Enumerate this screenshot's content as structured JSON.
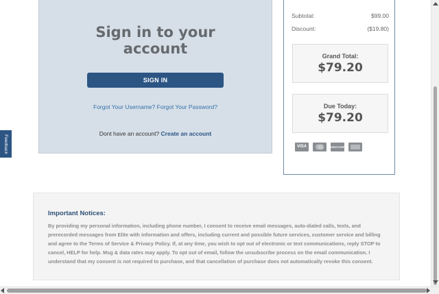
{
  "signin": {
    "title_line1": "Sign in to your",
    "title_line2": "account",
    "button_label": "SIGN IN",
    "forgot_username": "Forgot Your Username?",
    "forgot_password": "Forgot Your Password?",
    "no_account_text": "Dont have an account?",
    "create_account": "Create an account"
  },
  "summary": {
    "subtotal_label": "Subtotal:",
    "subtotal_value": "$99.00",
    "discount_label": "Discount:",
    "discount_value": "($19.80)",
    "grand_total_label": "Grand Total:",
    "grand_total_value": "$79.20",
    "due_today_label": "Due Today:",
    "due_today_value": "$79.20",
    "cards": [
      "VISA",
      "MasterCard",
      "DISCOVER",
      "AMERICAN EXPRESS"
    ]
  },
  "feedback": {
    "label": "Feedback"
  },
  "notices": {
    "title": "Important Notices:",
    "text": "By providing my personal information, including phone number, I consent to receive email messages, auto-dialed calls, texts, and prerecorded messages from Elite with information and offers, including current and possible future services, customer service and billing and agree to the Terms of Service & Privacy Policy. If, at any time, you wish to opt out of electronic or text communications, reply STOP to cancel, HELP for help. Msg & data rates may apply. To opt out of email, follow the unsubscribe process on the email communication. I understand that my consent is not required to purchase, and that cancellation of purchase does not automatically revoke this consent."
  },
  "colors": {
    "panel_bg": "#d6dfe8",
    "primary_button": "#2c5584",
    "link": "#3670a8",
    "notices_title": "#2c4f74"
  }
}
